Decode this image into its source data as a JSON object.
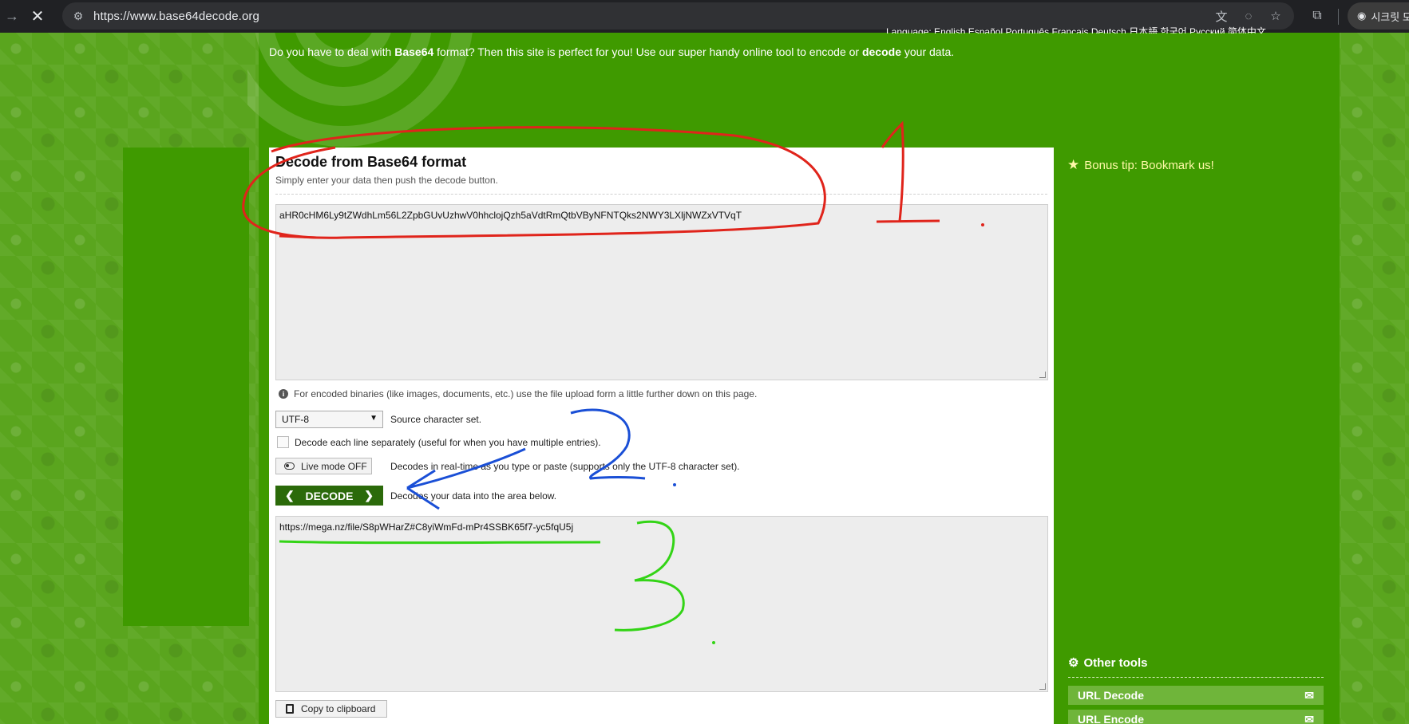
{
  "browser": {
    "url": "https://www.base64decode.org",
    "profile_label": "시크릿 모"
  },
  "site": {
    "top_nav": "Language:   English   Español   Português   Français   Deutsch   日本語   한국어   Русский   简体中文",
    "intro_pre": "Do you have to deal with ",
    "intro_b1": "Base64",
    "intro_mid": " format? Then this site is perfect for you! Use our super handy online tool to encode or ",
    "intro_b2": "decode",
    "intro_post": " your data."
  },
  "panel": {
    "title": "Decode from Base64 format",
    "subtitle": "Simply enter your data then push the decode button.",
    "input_value": "aHR0cHM6Ly9tZWdhLm56L2ZpbGUvUzhwV0hhclojQzh5aVdtRmQtbVByNFNTQks2NWY3LXljNWZxVTVqT",
    "binary_note": "For encoded binaries (like images, documents, etc.) use the file upload form a little further down on this page.",
    "charset_value": "UTF-8",
    "charset_label": "Source character set.",
    "line_sep_label": "Decode each line separately (useful for when you have multiple entries).",
    "live_mode_label": "Live mode OFF",
    "live_mode_desc": "Decodes in real-time as you type or paste (supports only the UTF-8 character set).",
    "decode_label": "DECODE",
    "decode_desc": "Decodes your data into the area below.",
    "output_value": "https://mega.nz/file/S8pWHarZ#C8yiWmFd-mPr4SSBK65f7-yc5fqU5j",
    "copy_label": "Copy to clipboard"
  },
  "sidebar": {
    "bonus_tip": "Bonus tip: Bookmark us!",
    "other_tools": "Other tools",
    "tools": [
      "URL Decode",
      "URL Encode"
    ]
  },
  "annotations": {
    "mark_1": "1",
    "mark_2": "2",
    "mark_3": "3",
    "colors": {
      "red": "#e0241b",
      "blue": "#1a4fd6",
      "green": "#33d416"
    }
  },
  "colors": {
    "page_green": "#5aa51e",
    "main_green": "#3f9a00",
    "decode_btn": "#2b6a0a",
    "bonus_yellow": "#fff9a8"
  }
}
